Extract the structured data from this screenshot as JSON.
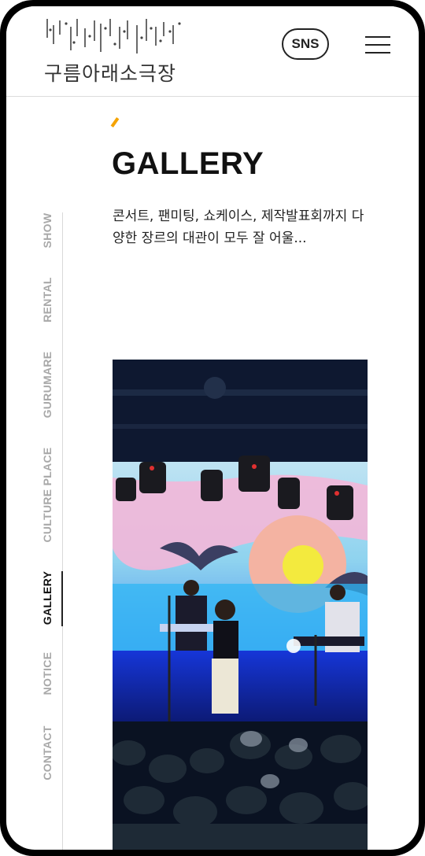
{
  "header": {
    "logo_text": "구름아래소극장",
    "sns_label": "SNS"
  },
  "page": {
    "title": "GALLERY",
    "description": "콘서트, 팬미팅, 쇼케이스, 제작발표회까지 다양한 장르의 대관이 모두 잘 어울..."
  },
  "side_nav": {
    "items": [
      {
        "label": "SHOW",
        "active": false
      },
      {
        "label": "RENTAL",
        "active": false
      },
      {
        "label": "GURUMARE",
        "active": false
      },
      {
        "label": "CULTURE PLACE",
        "active": false
      },
      {
        "label": "GALLERY",
        "active": true
      },
      {
        "label": "NOTICE",
        "active": false
      },
      {
        "label": "CONTACT",
        "active": false
      }
    ]
  },
  "colors": {
    "accent": "#f5a300",
    "active_nav": "#111111",
    "inactive_nav": "#a8a8a8"
  },
  "icons": {
    "menu": "hamburger-menu-icon",
    "accent": "accent-slash-icon"
  }
}
